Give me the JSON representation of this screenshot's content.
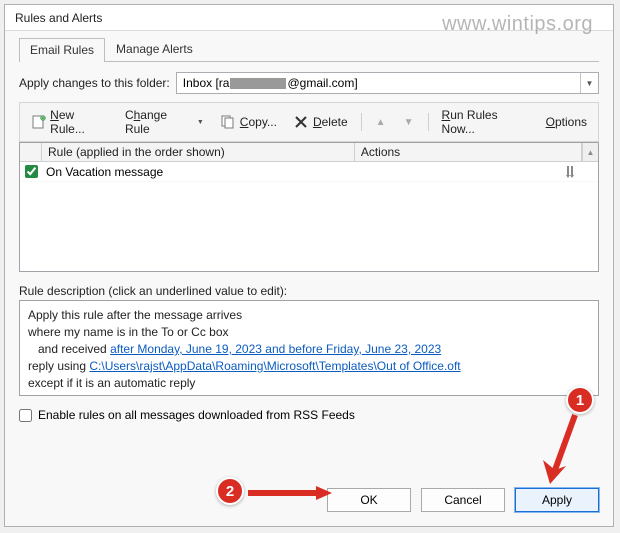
{
  "watermark": "www.wintips.org",
  "titlebar": "Rules and Alerts",
  "tabs": {
    "email_rules": "Email Rules",
    "manage_alerts": "Manage Alerts"
  },
  "folder": {
    "label": "Apply changes to this folder:",
    "prefix": "Inbox [ra",
    "suffix": "@gmail.com]"
  },
  "toolbar": {
    "new_rule_pre": "",
    "new_rule": "New Rule...",
    "change_rule": "Change Rule",
    "copy": "Copy...",
    "delete": "Delete",
    "run_rules": "Run Rules Now...",
    "options": "Options"
  },
  "grid": {
    "header_rule": "Rule (applied in the order shown)",
    "header_actions": "Actions",
    "rows": [
      {
        "checked": true,
        "name": "On Vacation message",
        "action_icon": "tools"
      }
    ]
  },
  "description": {
    "label": "Rule description (click an underlined value to edit):",
    "line1": "Apply this rule after the message arrives",
    "line2": "where my name is in the To or Cc box",
    "line3_prefix": "   and received ",
    "line3_link": "after Monday, June 19, 2023 and before Friday, June 23, 2023",
    "line4_prefix": "reply using ",
    "line4_link": "C:\\Users\\rajst\\AppData\\Roaming\\Microsoft\\Templates\\Out of Office.oft",
    "line5": "except if it is an automatic reply"
  },
  "rss": {
    "label": "Enable rules on all messages downloaded from RSS Feeds"
  },
  "buttons": {
    "ok": "OK",
    "cancel": "Cancel",
    "apply": "Apply"
  },
  "annotations": {
    "bubble1": "1",
    "bubble2": "2"
  }
}
